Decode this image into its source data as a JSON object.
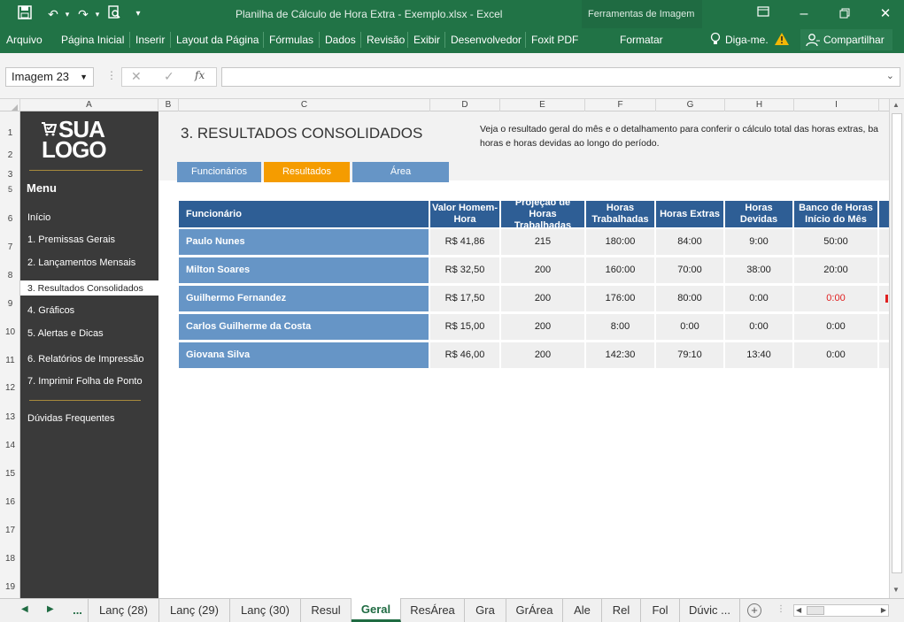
{
  "titlebar": {
    "window_title": "Planilha de Cálculo de Hora Extra - Exemplo.xlsx - Excel",
    "tools_label": "Ferramentas de Imagem"
  },
  "ribbon": {
    "tabs": [
      "Arquivo",
      "Página Inicial",
      "Inserir",
      "Layout da Página",
      "Fórmulas",
      "Dados",
      "Revisão",
      "Exibir",
      "Desenvolvedor",
      "Foxit PDF"
    ],
    "format_tab": "Formatar",
    "tellme": "Diga-me.",
    "share": "Compartilhar"
  },
  "formula_bar": {
    "name_box": "Imagem 23",
    "fx": "fx"
  },
  "columns": [
    "A",
    "B",
    "C",
    "D",
    "E",
    "F",
    "G",
    "H",
    "I"
  ],
  "rows": [
    "1",
    "2",
    "3",
    "5",
    "6",
    "7",
    "8",
    "9",
    "10",
    "11",
    "12",
    "13",
    "14",
    "15",
    "16",
    "17",
    "18",
    "19"
  ],
  "sidebar": {
    "logo_line1": "SUA",
    "logo_line2": "LOGO",
    "menu_title": "Menu",
    "items": [
      "Início",
      "1. Premissas Gerais",
      "2. Lançamentos Mensais",
      "3. Resultados Consolidados",
      "4. Gráficos",
      "5. Alertas e Dicas",
      "6. Relatórios de Impressão",
      "7. Imprimir Folha de Ponto",
      "Dúvidas Frequentes"
    ]
  },
  "sheet": {
    "title": "3. RESULTADOS CONSOLIDADOS",
    "description_line1": "Veja o resultado geral do mês e o detalhamento para conferir o cálculo total das horas extras, ba",
    "description_line2": "horas e horas devidas ao longo do período.",
    "tabs": [
      "Funcionários",
      "Resultados",
      "Área"
    ],
    "headers": [
      "Funcionário",
      "Valor Homem-Hora",
      "Projeção de Horas Trabalhadas",
      "Horas Trabalhadas",
      "Horas Extras",
      "Horas Devidas",
      "Banco de Horas Início do Mês"
    ],
    "rows": [
      {
        "name": "Paulo Nunes",
        "valor": "R$ 41,86",
        "projecao": "215",
        "trabalhadas": "180:00",
        "extras": "84:00",
        "devidas": "9:00",
        "banco": "50:00"
      },
      {
        "name": "Milton Soares",
        "valor": "R$ 32,50",
        "projecao": "200",
        "trabalhadas": "160:00",
        "extras": "70:00",
        "devidas": "38:00",
        "banco": "20:00"
      },
      {
        "name": "Guilhermo Fernandez",
        "valor": "R$ 17,50",
        "projecao": "200",
        "trabalhadas": "176:00",
        "extras": "80:00",
        "devidas": "0:00",
        "banco": "0:00"
      },
      {
        "name": "Carlos Guilherme da Costa",
        "valor": "R$ 15,00",
        "projecao": "200",
        "trabalhadas": "8:00",
        "extras": "0:00",
        "devidas": "0:00",
        "banco": "0:00"
      },
      {
        "name": "Giovana Silva",
        "valor": "R$ 46,00",
        "projecao": "200",
        "trabalhadas": "142:30",
        "extras": "79:10",
        "devidas": "13:40",
        "banco": "0:00"
      }
    ]
  },
  "sheet_tabs": [
    "...",
    "Lanç (28)",
    "Lanç (29)",
    "Lanç (30)",
    "Resul",
    "Geral",
    "ResÁrea",
    "Gra",
    "GrÁrea",
    "Ale",
    "Rel",
    "Fol",
    "Dúvic ..."
  ],
  "colors": {
    "excel_green": "#217346",
    "accent_orange": "#f59c00",
    "tab_blue": "#6695c6",
    "header_blue": "#2e5e95",
    "warning_red": "#e02020"
  }
}
